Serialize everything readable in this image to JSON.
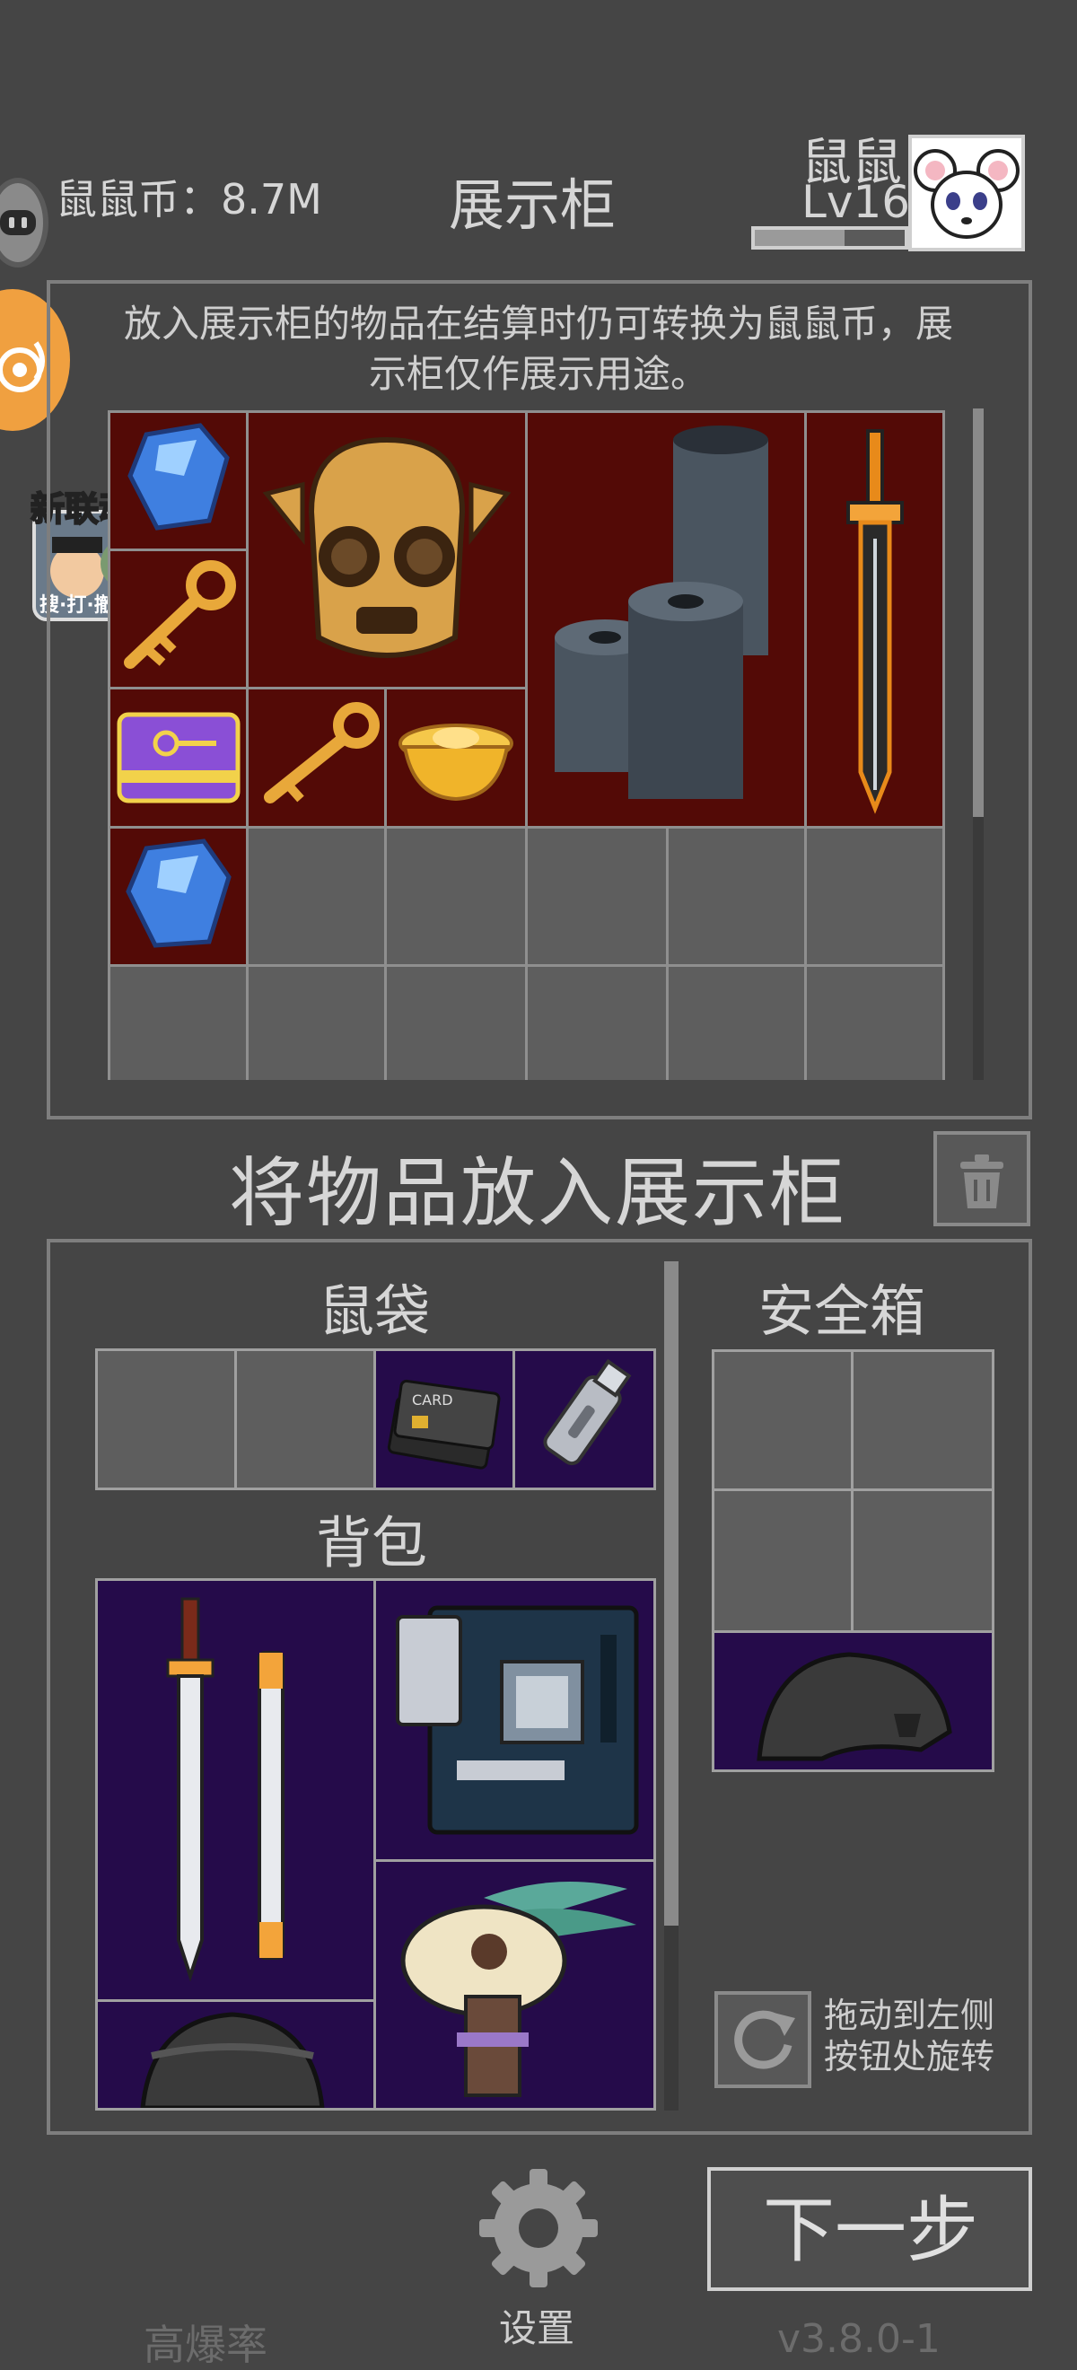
{
  "header": {
    "coin_label": "鼠鼠币：8.7M",
    "title": "展示柜",
    "player_name": "鼠鼠",
    "player_level": "Lv16",
    "xp_fraction": 0.6
  },
  "showcase": {
    "note": "放入展示柜的物品在结算时仍可转换为鼠鼠币，展示柜仅作展示用途。",
    "items": [
      {
        "name": "blue-crystal-icon"
      },
      {
        "name": "golden-key-icon"
      },
      {
        "name": "golden-mask-icon"
      },
      {
        "name": "steel-rolls-icon"
      },
      {
        "name": "golden-sword-icon"
      },
      {
        "name": "purple-keycard-icon"
      },
      {
        "name": "golden-key-icon"
      },
      {
        "name": "gold-ingot-icon"
      },
      {
        "name": "blue-crystal-icon"
      }
    ]
  },
  "put_section": {
    "title": "将物品放入展示柜",
    "trash_icon": "trash-icon"
  },
  "inventory": {
    "bag_title": "鼠袋",
    "pack_title": "背包",
    "safe_title": "安全箱",
    "bag_items": [
      {
        "name": "bank-cards-icon"
      },
      {
        "name": "usb-drive-icon"
      }
    ],
    "pack_items": [
      {
        "name": "swords-icon"
      },
      {
        "name": "motherboard-icon"
      },
      {
        "name": "skull-totem-icon"
      },
      {
        "name": "helmet-icon"
      }
    ],
    "safe_items": [
      {
        "name": "helmet-icon"
      }
    ],
    "rotate_hint_line1": "拖动到左侧",
    "rotate_hint_line2": "按钮处旋转"
  },
  "bottom": {
    "settings_label": "设置",
    "next_label": "下一步",
    "high_rate_label": "高爆率",
    "version": "v3.8.0-1"
  },
  "float": {
    "collab_label": "新联动",
    "collab_sub": "搜·打·撤"
  },
  "colors": {
    "background": "#454545",
    "showcase_filled": "#530a06",
    "inventory_filled": "#250b4a",
    "empty_slot": "#5e5e5e"
  }
}
